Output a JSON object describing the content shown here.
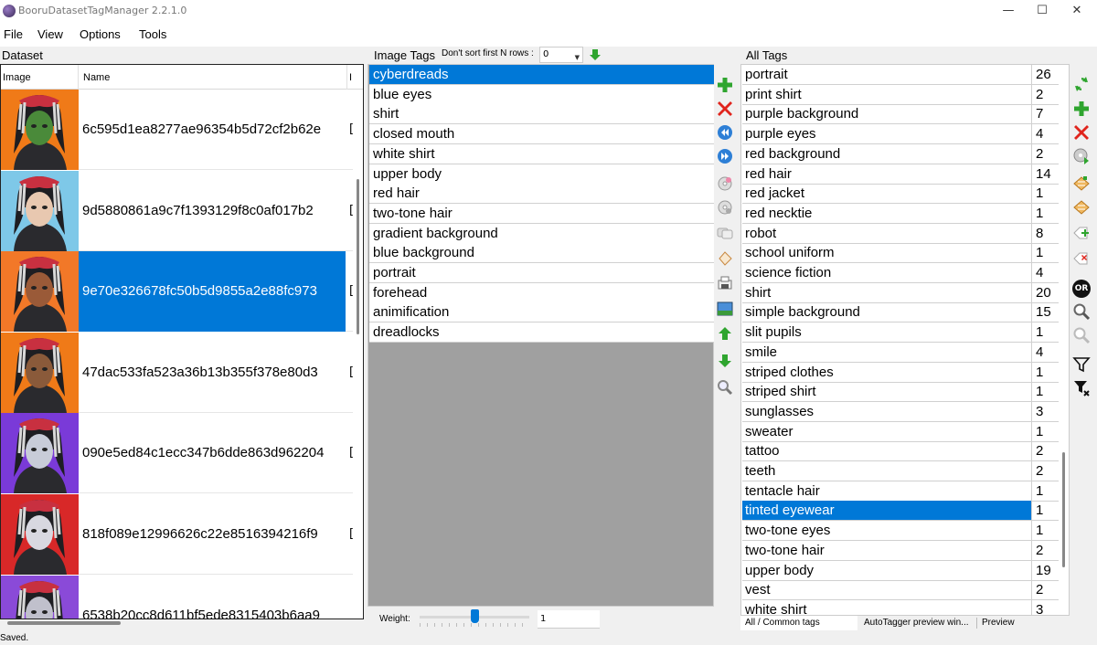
{
  "window": {
    "title": "BooruDatasetTagManager 2.2.1.0",
    "minimize": "—",
    "maximize": "☐",
    "close": "✕"
  },
  "menu": [
    "File",
    "View",
    "Options",
    "Tools"
  ],
  "dataset": {
    "label": "Dataset",
    "col_image": "Image",
    "col_name": "Name",
    "col_extra": "I",
    "rows": [
      {
        "name": "6c595d1ea8277ae96354b5d72cf2b62e",
        "extra": "[",
        "bg": "#f07a18",
        "skin": "#4a8a3a",
        "selected": false
      },
      {
        "name": "9d5880861a9c7f1393129f8c0af017b2",
        "extra": "[",
        "bg": "#7ec8e8",
        "skin": "#e8c8b0",
        "selected": false
      },
      {
        "name": "9e70e326678fc50b5d9855a2e88fc973",
        "extra": "[",
        "bg": "#f27828",
        "skin": "#9a5a38",
        "selected": true
      },
      {
        "name": "47dac533fa523a36b13b355f378e80d3",
        "extra": "[",
        "bg": "#f07a18",
        "skin": "#8a5a3a",
        "selected": false
      },
      {
        "name": "090e5ed84c1ecc347b6dde863d962204",
        "extra": "[",
        "bg": "#7a3ad8",
        "skin": "#c8ccd8",
        "selected": false
      },
      {
        "name": "818f089e12996626c22e8516394216f9",
        "extra": "[",
        "bg": "#d82828",
        "skin": "#d8d8e0",
        "selected": false
      },
      {
        "name": "6538b20cc8d611bf5ede8315403b6aa9",
        "extra": "",
        "bg": "#8a4ad8",
        "skin": "#c0c0cc",
        "selected": false
      }
    ]
  },
  "image_tags": {
    "label": "Image Tags",
    "sort_label": "Don't sort first N rows :",
    "sort_value": "0",
    "tags": [
      {
        "text": "cyberdreads",
        "selected": true
      },
      {
        "text": "blue eyes",
        "selected": false
      },
      {
        "text": "shirt",
        "selected": false
      },
      {
        "text": "closed mouth",
        "selected": false
      },
      {
        "text": "white shirt",
        "selected": false
      },
      {
        "text": "upper body",
        "selected": false
      },
      {
        "text": "red hair",
        "selected": false
      },
      {
        "text": "two-tone hair",
        "selected": false
      },
      {
        "text": "gradient background",
        "selected": false
      },
      {
        "text": "blue background",
        "selected": false
      },
      {
        "text": "portrait",
        "selected": false
      },
      {
        "text": "forehead",
        "selected": false
      },
      {
        "text": "animification",
        "selected": false
      },
      {
        "text": "dreadlocks",
        "selected": false
      }
    ],
    "weight_label": "Weight:",
    "weight_value": "1",
    "weight_level": 0.5
  },
  "all_tags": {
    "label": "All Tags",
    "tags": [
      {
        "name": "portrait",
        "count": "26",
        "selected": false
      },
      {
        "name": "print shirt",
        "count": "2",
        "selected": false
      },
      {
        "name": "purple background",
        "count": "7",
        "selected": false
      },
      {
        "name": "purple eyes",
        "count": "4",
        "selected": false
      },
      {
        "name": "red background",
        "count": "2",
        "selected": false
      },
      {
        "name": "red hair",
        "count": "14",
        "selected": false
      },
      {
        "name": "red jacket",
        "count": "1",
        "selected": false
      },
      {
        "name": "red necktie",
        "count": "1",
        "selected": false
      },
      {
        "name": "robot",
        "count": "8",
        "selected": false
      },
      {
        "name": "school uniform",
        "count": "1",
        "selected": false
      },
      {
        "name": "science fiction",
        "count": "4",
        "selected": false
      },
      {
        "name": "shirt",
        "count": "20",
        "selected": false
      },
      {
        "name": "simple background",
        "count": "15",
        "selected": false
      },
      {
        "name": "slit pupils",
        "count": "1",
        "selected": false
      },
      {
        "name": "smile",
        "count": "4",
        "selected": false
      },
      {
        "name": "striped clothes",
        "count": "1",
        "selected": false
      },
      {
        "name": "striped shirt",
        "count": "1",
        "selected": false
      },
      {
        "name": "sunglasses",
        "count": "3",
        "selected": false
      },
      {
        "name": "sweater",
        "count": "1",
        "selected": false
      },
      {
        "name": "tattoo",
        "count": "2",
        "selected": false
      },
      {
        "name": "teeth",
        "count": "2",
        "selected": false
      },
      {
        "name": "tentacle hair",
        "count": "1",
        "selected": false
      },
      {
        "name": "tinted eyewear",
        "count": "1",
        "selected": true
      },
      {
        "name": "two-tone eyes",
        "count": "1",
        "selected": false
      },
      {
        "name": "two-tone hair",
        "count": "2",
        "selected": false
      },
      {
        "name": "upper body",
        "count": "19",
        "selected": false
      },
      {
        "name": "vest",
        "count": "2",
        "selected": false
      },
      {
        "name": "white shirt",
        "count": "3",
        "selected": false
      }
    ],
    "tabs": [
      "All / Common tags",
      "AutoTagger preview win...",
      "Preview"
    ]
  },
  "middle_toolbar": [
    "add-tag-icon",
    "delete-tag-icon",
    "move-tag-top-icon",
    "move-tag-bottom-icon",
    "copy-tags-icon",
    "paste-tags-icon",
    "replace-tags-icon",
    "clear-tags-icon",
    "translate-tags-icon",
    "show-image-icon",
    "move-up-icon",
    "move-down-icon",
    "find-tag-icon"
  ],
  "right_toolbar": [
    "reload-icon",
    "add-tag-icon",
    "delete-tag-icon",
    "replace-all-icon",
    "add-to-all-icon",
    "add-to-selected-icon",
    "add-filter-tag-icon",
    "remove-filter-tag-icon",
    "or-filter-icon",
    "search-icon",
    "search-next-icon",
    "filter-icon",
    "clear-filter-icon"
  ],
  "toolbar_or_text": "OR",
  "status": "Saved.",
  "colors": {
    "selection": "#0078d7",
    "empty_area": "#a0a0a0",
    "green": "#2fa52f",
    "red": "#e0241c",
    "blue": "#2d7fd6"
  }
}
